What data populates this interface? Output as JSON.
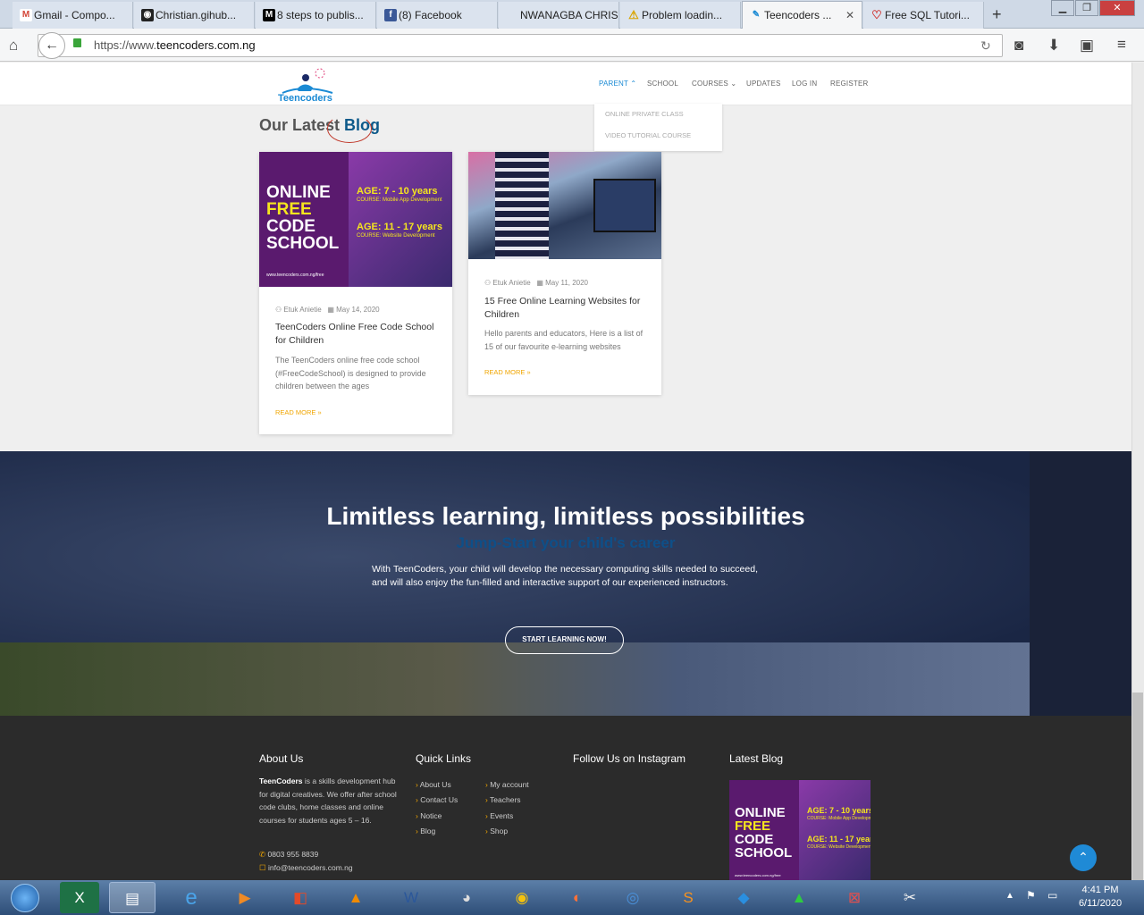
{
  "browser": {
    "tabs": [
      {
        "label": "Gmail - Compo...",
        "icon": "gmail-icon",
        "color": "#d44638"
      },
      {
        "label": "Christian.gihub...",
        "icon": "github-icon",
        "color": "#222222"
      },
      {
        "label": "8 steps to publis...",
        "icon": "medium-icon",
        "color": "#000000"
      },
      {
        "label": "(8) Facebook",
        "icon": "facebook-icon",
        "color": "#3b5998"
      },
      {
        "label": "NWANAGBA CHRIS...",
        "icon": "page-icon",
        "color": "#dbe3ee"
      },
      {
        "label": "Problem loadin...",
        "icon": "warning-icon",
        "color": "#e8b400"
      },
      {
        "label": "Teencoders ...",
        "icon": "teencoders-icon",
        "color": "#1a8ad4"
      },
      {
        "label": "Free SQL Tutori...",
        "icon": "sql-icon",
        "color": "#d0312d"
      }
    ],
    "url_prefix": "https://www.",
    "url_domain": "teencoders.com.ng"
  },
  "site": {
    "logo_text": "Teencoders",
    "menu": [
      {
        "label": "PARENT ⌃"
      },
      {
        "label": "SCHOOL"
      },
      {
        "label": "COURSES ⌄"
      },
      {
        "label": "UPDATES"
      },
      {
        "label": "LOG IN"
      },
      {
        "label": "REGISTER"
      }
    ],
    "dropdown": [
      "ONLINE PRIVATE CLASS",
      "VIDEO TUTORIAL COURSE"
    ],
    "blog_heading_1": "Our Latest",
    "blog_heading_2": "Blog",
    "posts": [
      {
        "author": "Etuk Anietie",
        "date": "May 14, 2020",
        "title": "TeenCoders Online Free Code School for Children",
        "excerpt": "The TeenCoders online free code school (#FreeCodeSchool) is designed to provide children between the ages",
        "read_more": "READ MORE",
        "img_title": [
          "ONLINE",
          "FREE",
          "CODE",
          "SCHOOL"
        ],
        "img_age1": "AGE: 7 - 10 years",
        "img_course1": "COURSE: Mobile App Development",
        "img_age2": "AGE: 11 - 17 years",
        "img_course2": "COURSE: Website Development",
        "img_url": "www.teencoders.com.ng/free"
      },
      {
        "author": "Etuk Anietie",
        "date": "May 11, 2020",
        "title": "15 Free Online Learning Websites for Children",
        "excerpt": "Hello parents and educators, Here is a list of 15 of our favourite e-learning websites",
        "read_more": "READ MORE"
      }
    ],
    "hero": {
      "title": "Limitless learning, limitless possibilities",
      "subtitle": "Jump-Start your child's career",
      "text": "With TeenCoders, your child will develop the necessary computing skills needed to succeed, and will also enjoy the fun-filled and interactive support of our experienced instructors.",
      "button": "START LEARNING NOW!"
    },
    "footer": {
      "about_heading": "About Us",
      "about_brand": "TeenCoders",
      "about_text": " is a skills development hub for digital creatives. We offer after school code clubs, home classes and online courses for students ages 5 – 16.",
      "phone": "0803 955 8839",
      "email": "info@teencoders.com.ng",
      "quick_heading": "Quick Links",
      "links_col1": [
        "About Us",
        "Contact Us",
        "Notice",
        "Blog"
      ],
      "links_col2": [
        "My account",
        "Teachers",
        "Events",
        "Shop"
      ],
      "insta_heading": "Follow Us on Instagram",
      "latest_heading": "Latest Blog"
    }
  },
  "taskbar": {
    "time": "4:41 PM",
    "date": "6/11/2020"
  }
}
